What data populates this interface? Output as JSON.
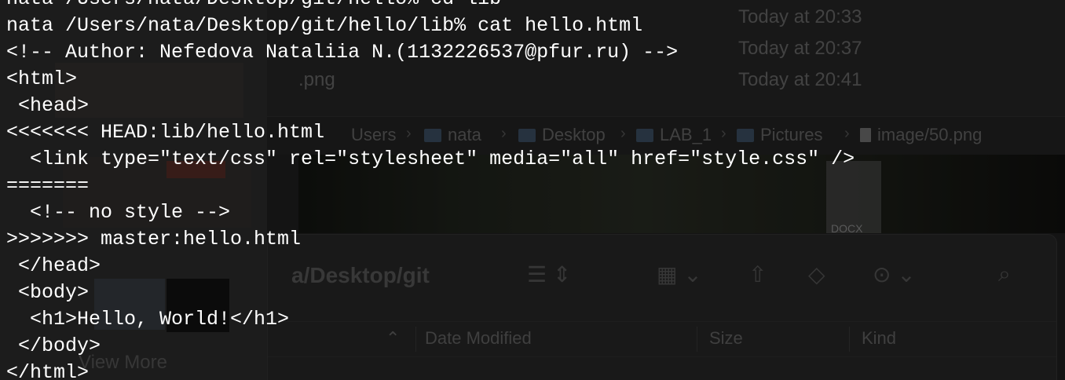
{
  "background": {
    "finder_recent_dates": [
      "Today at 20:33",
      "Today at 20:37",
      "Today at 20:41"
    ],
    "finder_recent_file": ".png",
    "pathbar": {
      "items": [
        {
          "label": "Users",
          "icon": "none"
        },
        {
          "label": "nata",
          "icon": "home-folder-icon"
        },
        {
          "label": "Desktop",
          "icon": "folder-icon"
        },
        {
          "label": "LAB_1",
          "icon": "folder-icon"
        },
        {
          "label": "Pictures",
          "icon": "folder-icon"
        },
        {
          "label": "image/50.png",
          "icon": "file-icon"
        }
      ]
    },
    "docx_label": "DOCX",
    "finder_window": {
      "title": "a/Desktop/git",
      "columns": [
        "Date Modified",
        "Size",
        "Kind"
      ]
    },
    "sidebar_view_more": "View More"
  },
  "terminal": {
    "lines": [
      "nata /Users/nata/Desktop/git/hello% cd lib",
      "nata /Users/nata/Desktop/git/hello/lib% cat hello.html",
      "<!-- Author: Nefedova Nataliia N.(1132226537@pfur.ru) -->",
      "<html>",
      " <head>",
      "<<<<<<< HEAD:lib/hello.html",
      "  <link type=\"text/css\" rel=\"stylesheet\" media=\"all\" href=\"style.css\" />",
      "=======",
      "  <!-- no style -->",
      ">>>>>>> master:hello.html",
      " </head>",
      " <body>",
      "  <h1>Hello, World!</h1>",
      " </body>",
      "</html>"
    ]
  }
}
